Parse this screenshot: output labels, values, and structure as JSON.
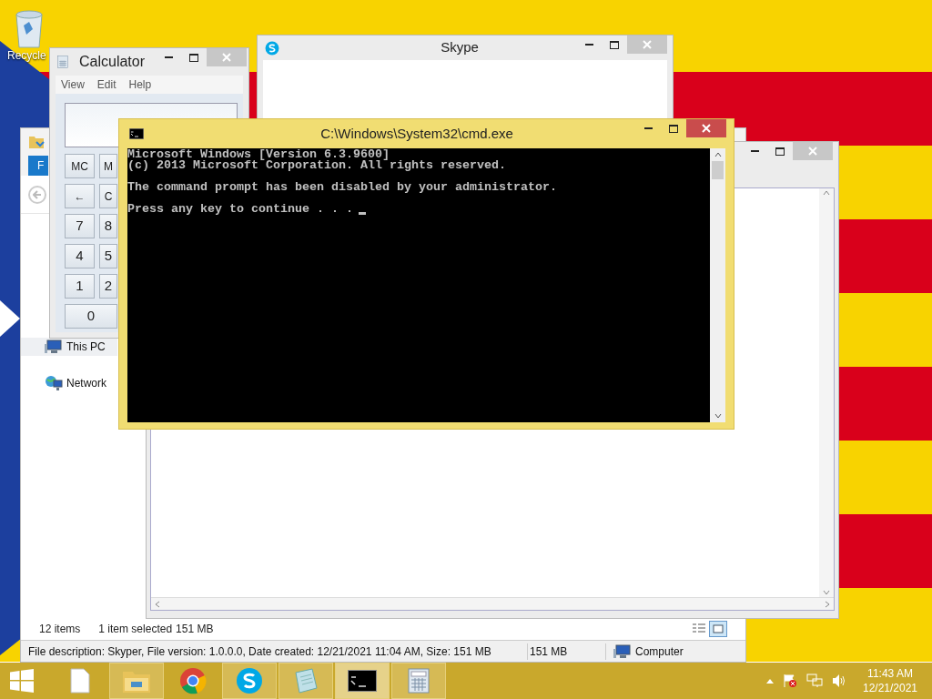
{
  "desktop_icons": [
    {
      "label": "Recycle"
    }
  ],
  "explorer": {
    "ribbon_tab": "F",
    "nav_items": [
      {
        "label": "This PC",
        "kind": "pc",
        "selected": true
      },
      {
        "label": "Network",
        "kind": "network",
        "selected": false
      }
    ],
    "item_count": "12 items",
    "selection": "1 item selected",
    "selection_size": "151 MB",
    "details": "File description: Skyper, File version: 1.0.0.0, Date created: 12/21/2021 11:04 AM, Size: 151 MB",
    "details_size": "151 MB",
    "zone": "Computer"
  },
  "skype": {
    "title": "Skype"
  },
  "calculator": {
    "title": "Calculator",
    "menu": [
      "View",
      "Edit",
      "Help"
    ],
    "rows": [
      [
        "MC",
        "M"
      ],
      [
        "←",
        "C"
      ],
      [
        "7",
        "8"
      ],
      [
        "4",
        "5"
      ],
      [
        "1",
        "2"
      ],
      [
        "0"
      ]
    ]
  },
  "cmd": {
    "title": "C:\\Windows\\System32\\cmd.exe",
    "blocks": [
      [
        "Microsoft Windows [Version 6.3.9600]",
        "(c) 2013 Microsoft Corporation. All rights reserved."
      ],
      [
        "The command prompt has been disabled by your administrator."
      ],
      [
        "Press any key to continue . . ."
      ]
    ]
  },
  "taskbar": {
    "apps": [
      {
        "kind": "file",
        "running": false,
        "selected": false
      },
      {
        "kind": "explorer",
        "running": true,
        "selected": false
      },
      {
        "kind": "chrome",
        "running": false,
        "selected": false
      },
      {
        "kind": "skype",
        "running": true,
        "selected": false
      },
      {
        "kind": "notepad",
        "running": true,
        "selected": false
      },
      {
        "kind": "cmd",
        "running": true,
        "selected": true
      },
      {
        "kind": "calculator",
        "running": true,
        "selected": false
      }
    ],
    "time": "11:43 AM",
    "date": "12/21/2021"
  }
}
